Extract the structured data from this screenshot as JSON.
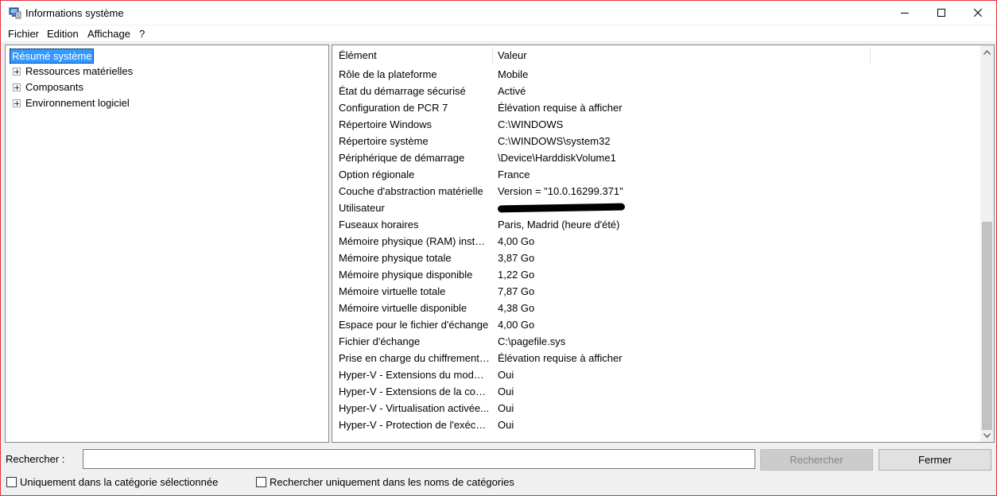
{
  "window": {
    "title": "Informations système"
  },
  "menu": {
    "items": [
      "Fichier",
      "Edition",
      "Affichage",
      "?"
    ]
  },
  "tree": {
    "root": "Résumé système",
    "children": [
      "Ressources matérielles",
      "Composants",
      "Environnement logiciel"
    ]
  },
  "list": {
    "columns": [
      "Élément",
      "Valeur"
    ],
    "rows": [
      {
        "element": "Rôle de la plateforme",
        "value": "Mobile"
      },
      {
        "element": "État du démarrage sécurisé",
        "value": "Activé"
      },
      {
        "element": "Configuration de PCR 7",
        "value": "Élévation requise à afficher"
      },
      {
        "element": "Répertoire Windows",
        "value": "C:\\WINDOWS"
      },
      {
        "element": "Répertoire système",
        "value": "C:\\WINDOWS\\system32"
      },
      {
        "element": "Périphérique de démarrage",
        "value": "\\Device\\HarddiskVolume1"
      },
      {
        "element": "Option régionale",
        "value": "France"
      },
      {
        "element": "Couche d'abstraction matérielle",
        "value": "Version = \"10.0.16299.371\""
      },
      {
        "element": "Utilisateur",
        "value": ""
      },
      {
        "element": "Fuseaux horaires",
        "value": "Paris, Madrid (heure d'été)"
      },
      {
        "element": "Mémoire physique (RAM) instal...",
        "value": "4,00 Go"
      },
      {
        "element": "Mémoire physique totale",
        "value": "3,87 Go"
      },
      {
        "element": "Mémoire physique disponible",
        "value": "1,22 Go"
      },
      {
        "element": "Mémoire virtuelle totale",
        "value": "7,87 Go"
      },
      {
        "element": "Mémoire virtuelle disponible",
        "value": "4,38 Go"
      },
      {
        "element": "Espace pour le fichier d'échange",
        "value": "4,00 Go"
      },
      {
        "element": "Fichier d'échange",
        "value": "C:\\pagefile.sys"
      },
      {
        "element": "Prise en charge du chiffrement ...",
        "value": "Élévation requise à afficher"
      },
      {
        "element": "Hyper-V - Extensions du mode ...",
        "value": "Oui"
      },
      {
        "element": "Hyper-V - Extensions de la con...",
        "value": "Oui"
      },
      {
        "element": "Hyper-V - Virtualisation activée...",
        "value": "Oui"
      },
      {
        "element": "Hyper-V - Protection de l'exécu...",
        "value": "Oui"
      }
    ]
  },
  "search": {
    "label": "Rechercher :",
    "value": "",
    "search_button": "Rechercher",
    "close_button": "Fermer",
    "option_category": "Uniquement dans la catégorie sélectionnée",
    "option_names": "Rechercher uniquement dans les noms de catégories"
  },
  "colors": {
    "selection": "#3399ff",
    "window_border": "#e0323c",
    "panel_border": "#828790"
  }
}
